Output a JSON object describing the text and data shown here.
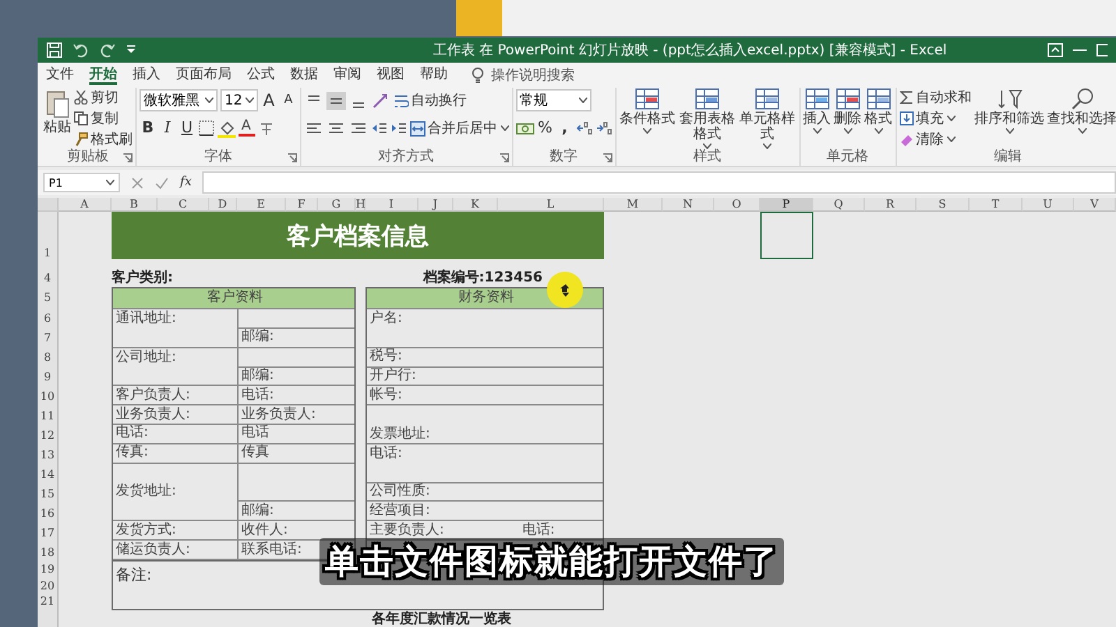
{
  "window": {
    "title": "工作表 在 PowerPoint 幻灯片放映 - (ppt怎么插入excel.pptx) [兼容模式] - Excel"
  },
  "menu": {
    "tabs": [
      {
        "label": "文件",
        "selected": false
      },
      {
        "label": "开始",
        "selected": true
      },
      {
        "label": "插入",
        "selected": false
      },
      {
        "label": "页面布局",
        "selected": false
      },
      {
        "label": "公式",
        "selected": false
      },
      {
        "label": "数据",
        "selected": false
      },
      {
        "label": "审阅",
        "selected": false
      },
      {
        "label": "视图",
        "selected": false
      },
      {
        "label": "帮助",
        "selected": false
      }
    ],
    "search": "操作说明搜索"
  },
  "ribbon": {
    "groups": [
      {
        "kind": "clipboard",
        "label": "剪贴板",
        "items": [
          "粘贴",
          "剪切",
          "复制",
          "格式刷"
        ]
      },
      {
        "kind": "font",
        "label": "字体",
        "font_name": "微软雅黑",
        "font_size": "12",
        "grow": "A",
        "shrink": "A",
        "bold": "B",
        "italic": "I",
        "underline": "U",
        "font_color": "A"
      },
      {
        "kind": "alignment",
        "label": "对齐方式",
        "vertical": [
          {
            "selected": false
          },
          {
            "selected": true
          },
          {
            "selected": false
          }
        ],
        "wrap": "自动换行",
        "merge": "合并后居中"
      },
      {
        "kind": "number",
        "label": "数字",
        "format": "常规",
        "percent": "%",
        "comma": ","
      },
      {
        "kind": "styles",
        "label": "样式",
        "items": [
          "条件格式",
          "套用表格格式",
          "单元格样式"
        ]
      },
      {
        "kind": "cells",
        "label": "单元格",
        "items": [
          "插入",
          "删除",
          "格式"
        ]
      },
      {
        "kind": "editing",
        "label": "编辑",
        "small": [
          "自动求和",
          "填充",
          "清除"
        ],
        "large": [
          "排序和筛选",
          "查找和选择"
        ]
      }
    ]
  },
  "formula_bar": {
    "name_box": "P1",
    "fx": "fx"
  },
  "sheet": {
    "columns": [
      {
        "label": "A",
        "selected": false
      },
      {
        "label": "B",
        "selected": false
      },
      {
        "label": "C",
        "selected": false
      },
      {
        "label": "D",
        "selected": false
      },
      {
        "label": "E",
        "selected": false
      },
      {
        "label": "F",
        "selected": false
      },
      {
        "label": "G",
        "selected": false
      },
      {
        "label": "H",
        "selected": false
      },
      {
        "label": "I",
        "selected": false
      },
      {
        "label": "J",
        "selected": false
      },
      {
        "label": "K",
        "selected": false
      },
      {
        "label": "L",
        "selected": false
      },
      {
        "label": "M",
        "selected": false
      },
      {
        "label": "N",
        "selected": false
      },
      {
        "label": "O",
        "selected": false
      },
      {
        "label": "P",
        "selected": true
      },
      {
        "label": "Q",
        "selected": false
      },
      {
        "label": "R",
        "selected": false
      },
      {
        "label": "S",
        "selected": false
      },
      {
        "label": "T",
        "selected": false
      },
      {
        "label": "U",
        "selected": false
      },
      {
        "label": "V",
        "selected": false
      }
    ],
    "rows": [
      "1",
      "4",
      "5",
      "6",
      "7",
      "8",
      "9",
      "10",
      "11",
      "12",
      "13",
      "14",
      "15",
      "16",
      "17",
      "18",
      "19",
      "20",
      "21"
    ],
    "form": {
      "title": "客户档案信息",
      "category": "客户类别:",
      "file_number": "档案编号:123456",
      "customer": {
        "header": "客户资料",
        "fields": [
          "通讯地址:",
          "邮编:",
          "公司地址:",
          "邮编:",
          "客户负责人:",
          "电话:",
          "业务负责人:",
          "业务负责人:",
          "电话:",
          "电话",
          "传真:",
          "传真",
          "发货地址:",
          "邮编:",
          "发货方式:",
          "收件人:",
          "储运负责人:",
          "联系电话:"
        ]
      },
      "finance": {
        "header": "财务资料",
        "fields": [
          "户名:",
          "税号:",
          "开户行:",
          "帐号:",
          "发票地址:",
          "电话:",
          "公司性质:",
          "经营项目:",
          "主要负责人:",
          "电话:"
        ]
      },
      "notes": "备注:",
      "next_section": "各年度汇款情况一览表"
    }
  },
  "subtitle": "单击文件图标就能打开文件了"
}
